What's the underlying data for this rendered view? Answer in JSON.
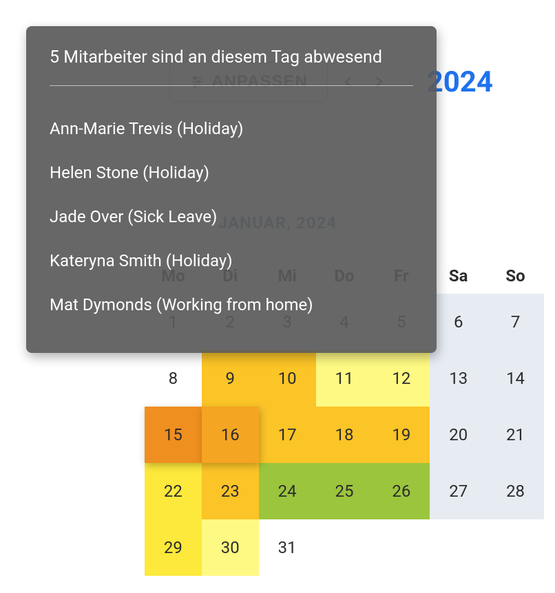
{
  "header": {
    "customize_label": "ANPASSEN",
    "year": "2024"
  },
  "calendar": {
    "month_label": "JANUAR, 2024",
    "dow": [
      "Mo",
      "Di",
      "Mi",
      "Do",
      "Fr",
      "Sa",
      "So"
    ],
    "weeks": [
      [
        {
          "d": "1",
          "cls": ""
        },
        {
          "d": "2",
          "cls": ""
        },
        {
          "d": "3",
          "cls": ""
        },
        {
          "d": "4",
          "cls": ""
        },
        {
          "d": "5",
          "cls": ""
        },
        {
          "d": "6",
          "cls": "weekend"
        },
        {
          "d": "7",
          "cls": "weekend"
        }
      ],
      [
        {
          "d": "8",
          "cls": ""
        },
        {
          "d": "9",
          "cls": "h3"
        },
        {
          "d": "10",
          "cls": "h3"
        },
        {
          "d": "11",
          "cls": "h1"
        },
        {
          "d": "12",
          "cls": "h1"
        },
        {
          "d": "13",
          "cls": "weekend"
        },
        {
          "d": "14",
          "cls": "weekend"
        }
      ],
      [
        {
          "d": "15",
          "cls": "h5 shadowed"
        },
        {
          "d": "16",
          "cls": "h4 shadowed"
        },
        {
          "d": "17",
          "cls": "h3"
        },
        {
          "d": "18",
          "cls": "h3"
        },
        {
          "d": "19",
          "cls": "h3"
        },
        {
          "d": "20",
          "cls": "weekend"
        },
        {
          "d": "21",
          "cls": "weekend"
        }
      ],
      [
        {
          "d": "22",
          "cls": "h2"
        },
        {
          "d": "23",
          "cls": "h3"
        },
        {
          "d": "24",
          "cls": "hg"
        },
        {
          "d": "25",
          "cls": "hg"
        },
        {
          "d": "26",
          "cls": "hg"
        },
        {
          "d": "27",
          "cls": "weekend"
        },
        {
          "d": "28",
          "cls": "weekend"
        }
      ],
      [
        {
          "d": "29",
          "cls": "h2"
        },
        {
          "d": "30",
          "cls": "h1"
        },
        {
          "d": "31",
          "cls": ""
        },
        {
          "d": "",
          "cls": ""
        },
        {
          "d": "",
          "cls": ""
        },
        {
          "d": "",
          "cls": ""
        },
        {
          "d": "",
          "cls": ""
        }
      ]
    ]
  },
  "tooltip": {
    "title": "5 Mitarbeiter sind an diesem Tag abwesend",
    "items": [
      "Ann-Marie Trevis (Holiday)",
      "Helen Stone (Holiday)",
      "Jade Over (Sick Leave)",
      "Kateryna Smith (Holiday)",
      "Mat Dymonds (Working from home)"
    ]
  }
}
